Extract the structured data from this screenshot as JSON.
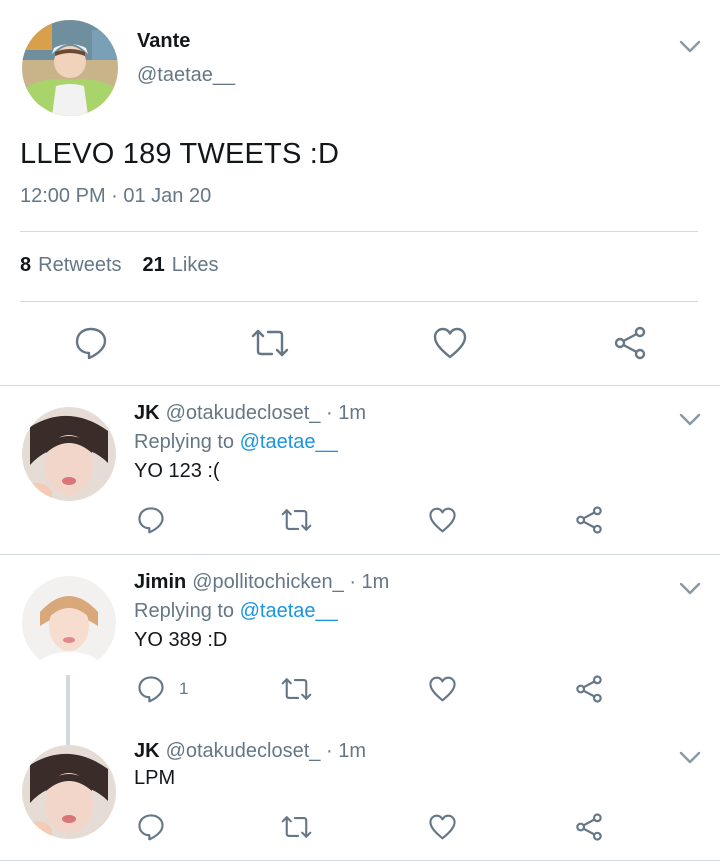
{
  "tweet": {
    "name": "Vante",
    "handle": "@taetae__",
    "text": "LLEVO 189 TWEETS :D",
    "time": "12:00 PM · 01 Jan 20",
    "retweets_count": "8",
    "retweets_label": "Retweets",
    "likes_count": "21",
    "likes_label": "Likes"
  },
  "replies": [
    {
      "name": "JK",
      "handle": "@otakudecloset_",
      "age": "· 1m",
      "replying_prefix": "Replying to",
      "replying_handle": "@taetae__",
      "text": "YO 123 :(",
      "reply_count": ""
    },
    {
      "name": "Jimin",
      "handle": "@pollitochicken_",
      "age": "· 1m",
      "replying_prefix": "Replying to",
      "replying_handle": "@taetae__",
      "text": "YO 389 :D",
      "reply_count": "1"
    },
    {
      "name": "JK",
      "handle": "@otakudecloset_",
      "age": "· 1m",
      "text": "LPM",
      "reply_count": ""
    }
  ],
  "icons": {
    "reply": "speech-bubble-icon",
    "retweet": "retweet-arrows-icon",
    "like": "heart-icon",
    "share": "share-nodes-icon",
    "menu": "chevron-down-icon"
  },
  "colors": {
    "text": "#14171a",
    "secondary": "#657786",
    "link": "#1b95e0",
    "divider": "#cfd9de",
    "icon": "#657786"
  }
}
